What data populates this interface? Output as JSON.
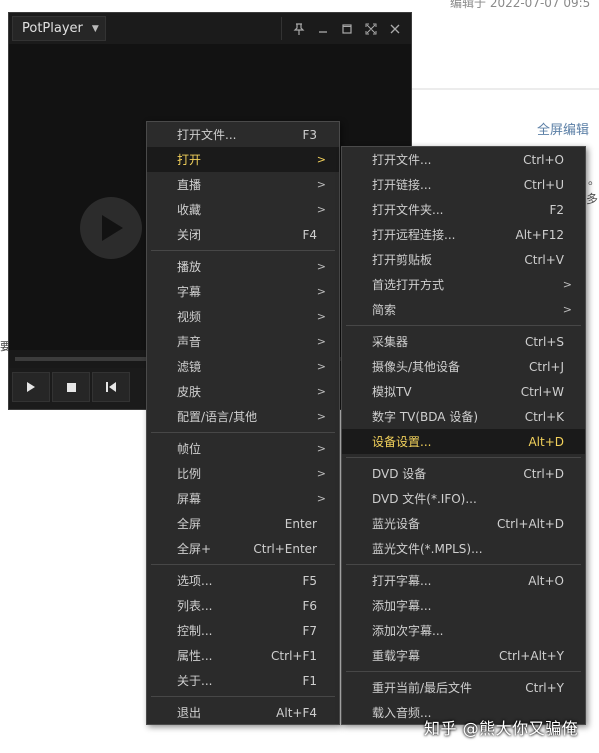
{
  "background": {
    "top_text": "编辑于 2022-07-07 09:5",
    "fullscreen_edit": "全屏编辑",
    "fragments": [
      "。",
      "多",
      "要"
    ]
  },
  "window": {
    "app_name": "PotPlayer",
    "title_buttons": [
      "pin",
      "minimize",
      "maximize",
      "fullscreen",
      "close"
    ]
  },
  "main_menu": {
    "items": [
      {
        "label": "打开文件...",
        "shortcut": "F3",
        "submenu": false
      },
      {
        "label": "打开",
        "shortcut": "",
        "submenu": true,
        "highlighted": true
      },
      {
        "label": "直播",
        "shortcut": "",
        "submenu": true
      },
      {
        "label": "收藏",
        "shortcut": "",
        "submenu": true
      },
      {
        "label": "关闭",
        "shortcut": "F4",
        "submenu": false
      },
      {
        "label": "播放",
        "shortcut": "",
        "submenu": true
      },
      {
        "label": "字幕",
        "shortcut": "",
        "submenu": true
      },
      {
        "label": "视频",
        "shortcut": "",
        "submenu": true
      },
      {
        "label": "声音",
        "shortcut": "",
        "submenu": true
      },
      {
        "label": "滤镜",
        "shortcut": "",
        "submenu": true
      },
      {
        "label": "皮肤",
        "shortcut": "",
        "submenu": true
      },
      {
        "label": "配置/语言/其他",
        "shortcut": "",
        "submenu": true
      },
      {
        "label": "帧位",
        "shortcut": "",
        "submenu": true
      },
      {
        "label": "比例",
        "shortcut": "",
        "submenu": true
      },
      {
        "label": "屏幕",
        "shortcut": "",
        "submenu": true
      },
      {
        "label": "全屏",
        "shortcut": "Enter",
        "submenu": false
      },
      {
        "label": "全屏+",
        "shortcut": "Ctrl+Enter",
        "submenu": false
      },
      {
        "label": "选项...",
        "shortcut": "F5",
        "submenu": false
      },
      {
        "label": "列表...",
        "shortcut": "F6",
        "submenu": false
      },
      {
        "label": "控制...",
        "shortcut": "F7",
        "submenu": false
      },
      {
        "label": "属性...",
        "shortcut": "Ctrl+F1",
        "submenu": false
      },
      {
        "label": "关于...",
        "shortcut": "F1",
        "submenu": false
      },
      {
        "label": "退出",
        "shortcut": "Alt+F4",
        "submenu": false
      }
    ]
  },
  "open_submenu": {
    "items": [
      {
        "label": "打开文件...",
        "shortcut": "Ctrl+O",
        "submenu": false
      },
      {
        "label": "打开链接...",
        "shortcut": "Ctrl+U",
        "submenu": false
      },
      {
        "label": "打开文件夹...",
        "shortcut": "F2",
        "submenu": false
      },
      {
        "label": "打开远程连接...",
        "shortcut": "Alt+F12",
        "submenu": false
      },
      {
        "label": "打开剪贴板",
        "shortcut": "Ctrl+V",
        "submenu": false
      },
      {
        "label": "首选打开方式",
        "shortcut": "",
        "submenu": true
      },
      {
        "label": "简索",
        "shortcut": "",
        "submenu": true
      },
      {
        "label": "采集器",
        "shortcut": "Ctrl+S",
        "submenu": false
      },
      {
        "label": "摄像头/其他设备",
        "shortcut": "Ctrl+J",
        "submenu": false
      },
      {
        "label": "模拟TV",
        "shortcut": "Ctrl+W",
        "submenu": false
      },
      {
        "label": "数字 TV(BDA 设备)",
        "shortcut": "Ctrl+K",
        "submenu": false
      },
      {
        "label": "设备设置...",
        "shortcut": "Alt+D",
        "submenu": false,
        "highlighted": true
      },
      {
        "label": "DVD 设备",
        "shortcut": "Ctrl+D",
        "submenu": false
      },
      {
        "label": "DVD 文件(*.IFO)...",
        "shortcut": "",
        "submenu": false
      },
      {
        "label": "蓝光设备",
        "shortcut": "Ctrl+Alt+D",
        "submenu": false
      },
      {
        "label": "蓝光文件(*.MPLS)...",
        "shortcut": "",
        "submenu": false
      },
      {
        "label": "打开字幕...",
        "shortcut": "Alt+O",
        "submenu": false
      },
      {
        "label": "添加字幕...",
        "shortcut": "",
        "submenu": false
      },
      {
        "label": "添加次字幕...",
        "shortcut": "",
        "submenu": false
      },
      {
        "label": "重载字幕",
        "shortcut": "Ctrl+Alt+Y",
        "submenu": false
      },
      {
        "label": "重开当前/最后文件",
        "shortcut": "Ctrl+Y",
        "submenu": false
      },
      {
        "label": "载入音频...",
        "shortcut": "",
        "submenu": false
      }
    ]
  },
  "submenu_arrow": ">",
  "watermark": "知乎 @熊大你又骗俺",
  "colors": {
    "menu_bg": "#2b2b2b",
    "menu_text": "#cfcfcf",
    "highlight_text": "#f2d15b",
    "player_bg": "#121212"
  }
}
